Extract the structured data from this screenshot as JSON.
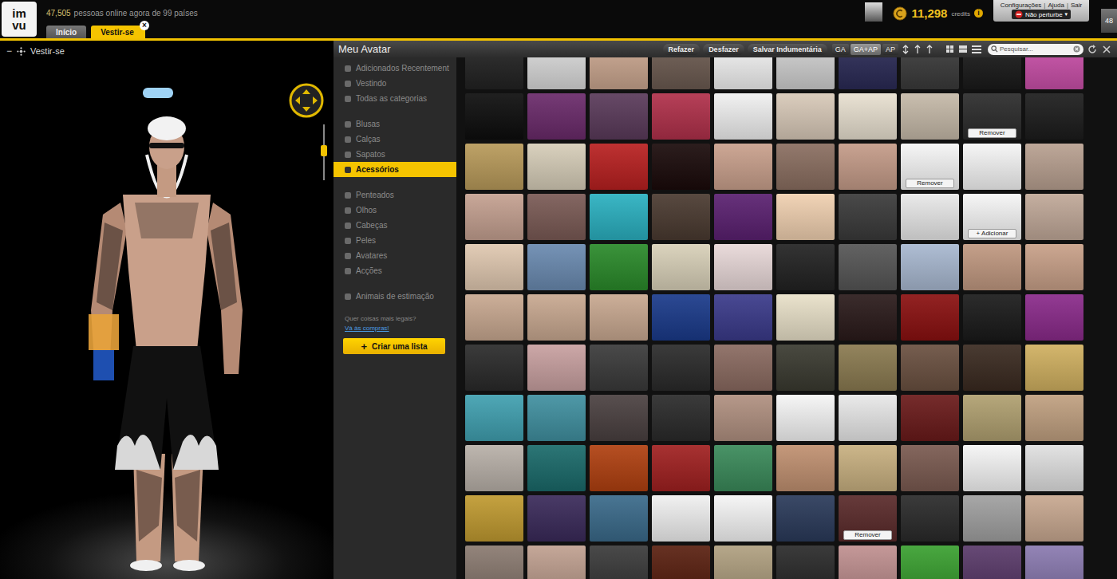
{
  "topbar": {
    "logo": [
      "im",
      "vu"
    ],
    "online": {
      "count": "47,505",
      "text": "pessoas online agora de 99 países"
    },
    "tabs": [
      {
        "label": "Início",
        "selected": false,
        "close": null
      },
      {
        "label": "Vestir-se",
        "selected": true,
        "close": "×"
      }
    ],
    "credits": {
      "amount": "11,298",
      "unit": "credits",
      "info": "i"
    },
    "links": [
      "Configurações",
      "Ajuda",
      "Sair"
    ],
    "separator": "|",
    "status": {
      "label": "Não perturbe",
      "arrow": "▾"
    },
    "badge": "48"
  },
  "stage": {
    "title": "Vestir-se",
    "collapse": "−"
  },
  "panel": {
    "title": "Meu Avatar",
    "buttons": [
      "Refazer",
      "Desfazer",
      "Salvar Indumentária"
    ],
    "filters": [
      {
        "label": "GA",
        "selected": false
      },
      {
        "label": "GA+AP",
        "selected": true
      },
      {
        "label": "AP",
        "selected": false
      }
    ],
    "search": {
      "placeholder": "Pesquisar..."
    }
  },
  "sidebar": {
    "groups": [
      [
        {
          "label": "Adicionados Recentement",
          "selected": false
        },
        {
          "label": "Vestindo",
          "selected": false
        },
        {
          "label": "Todas as categorias",
          "selected": false
        }
      ],
      [
        {
          "label": "Blusas",
          "selected": false
        },
        {
          "label": "Calças",
          "selected": false
        },
        {
          "label": "Sapatos",
          "selected": false
        },
        {
          "label": "Acessórios",
          "selected": true
        }
      ],
      [
        {
          "label": "Penteados",
          "selected": false
        },
        {
          "label": "Olhos",
          "selected": false
        },
        {
          "label": "Cabeças",
          "selected": false
        },
        {
          "label": "Peles",
          "selected": false
        },
        {
          "label": "Avatares",
          "selected": false
        },
        {
          "label": "Acções",
          "selected": false
        }
      ],
      [
        {
          "label": "Animais de estimação",
          "selected": false
        }
      ]
    ],
    "promo": "Quer coisas mais legais?",
    "promo_link": "Vá às compras!",
    "create": {
      "icon": "+",
      "label": "Criar uma lista"
    }
  },
  "tiles": [
    {
      "color": "#222222"
    },
    {
      "color": "#d9d9d9"
    },
    {
      "color": "#c9a58e"
    },
    {
      "color": "#6b5a50"
    },
    {
      "color": "#f2f2f2"
    },
    {
      "color": "#cfcfcf"
    },
    {
      "color": "#2a2a55"
    },
    {
      "color": "#3a3a3a"
    },
    {
      "color": "#1a1a1a"
    },
    {
      "color": "#c94fa8"
    },
    {
      "color": "#0d0d0d"
    },
    {
      "color": "#6a2a6a"
    },
    {
      "color": "#5a3a5a"
    },
    {
      "color": "#b0304a"
    },
    {
      "color": "#f0f0f0"
    },
    {
      "color": "#d8c9b8"
    },
    {
      "color": "#e8e0d0"
    },
    {
      "color": "#c5b9a8"
    },
    {
      "color": "#2b2b2b",
      "overlay": "Remover"
    },
    {
      "color": "#1c1c1c"
    },
    {
      "color": "#b89a5a"
    },
    {
      "color": "#d6cdb8"
    },
    {
      "color": "#b82020"
    },
    {
      "color": "#1a0a0a"
    },
    {
      "color": "#c9a08c"
    },
    {
      "color": "#8a6e60"
    },
    {
      "color": "#c49b88"
    },
    {
      "color": "#f5f5f5",
      "overlay": "Remover"
    },
    {
      "color": "#f5f5f5"
    },
    {
      "color": "#b8a090"
    },
    {
      "color": "#c4a090"
    },
    {
      "color": "#7a5a55"
    },
    {
      "color": "#2ab0c0"
    },
    {
      "color": "#4a3a30"
    },
    {
      "color": "#5a2070"
    },
    {
      "color": "#f0d0b0"
    },
    {
      "color": "#3a3a3a"
    },
    {
      "color": "#e8e8e8"
    },
    {
      "color": "#f5f5f5",
      "overlay": "+ Adicionar"
    },
    {
      "color": "#c0a898"
    },
    {
      "color": "#e0c8b0"
    },
    {
      "color": "#6a8ab0"
    },
    {
      "color": "#2a8a2a"
    },
    {
      "color": "#d8d0b8"
    },
    {
      "color": "#e8d8d8"
    },
    {
      "color": "#222222"
    },
    {
      "color": "#555555"
    },
    {
      "color": "#a8b8d0"
    },
    {
      "color": "#c09880"
    },
    {
      "color": "#c8a088"
    },
    {
      "color": "#c8a890"
    },
    {
      "color": "#c8a890"
    },
    {
      "color": "#c8a890"
    },
    {
      "color": "#1a3a8a"
    },
    {
      "color": "#3a3a8a"
    },
    {
      "color": "#e8e0c8"
    },
    {
      "color": "#2a1a1a"
    },
    {
      "color": "#8a1010"
    },
    {
      "color": "#1a1a1a"
    },
    {
      "color": "#8a2a8a"
    },
    {
      "color": "#2a2a2a"
    },
    {
      "color": "#c8a0a0"
    },
    {
      "color": "#3a3a3a"
    },
    {
      "color": "#2a2a2a"
    },
    {
      "color": "#8a6a60"
    },
    {
      "color": "#3a3a30"
    },
    {
      "color": "#8a7a50"
    },
    {
      "color": "#6a5040"
    },
    {
      "color": "#3a2a20"
    },
    {
      "color": "#d0b060"
    },
    {
      "color": "#40a0b0"
    },
    {
      "color": "#4090a0"
    },
    {
      "color": "#4a4040"
    },
    {
      "color": "#2a2a2a"
    },
    {
      "color": "#b09080"
    },
    {
      "color": "#f5f5f5"
    },
    {
      "color": "#e8e8e8"
    },
    {
      "color": "#6a1a1a"
    },
    {
      "color": "#b0a070"
    },
    {
      "color": "#c0a080"
    },
    {
      "color": "#b8b0a8"
    },
    {
      "color": "#1a6a6a"
    },
    {
      "color": "#b04010"
    },
    {
      "color": "#a02020"
    },
    {
      "color": "#3a8a5a"
    },
    {
      "color": "#c09070"
    },
    {
      "color": "#c8b080"
    },
    {
      "color": "#7a5a50"
    },
    {
      "color": "#f5f5f5"
    },
    {
      "color": "#e0e0e0"
    },
    {
      "color": "#c09a30"
    },
    {
      "color": "#3a2a5a"
    },
    {
      "color": "#3a6a8a"
    },
    {
      "color": "#f0f0f0"
    },
    {
      "color": "#f5f5f5"
    },
    {
      "color": "#2a3a5a"
    },
    {
      "color": "#5a2a2a",
      "overlay": "Remover"
    },
    {
      "color": "#2a2a2a"
    },
    {
      "color": "#a0a0a0"
    },
    {
      "color": "#c8a890"
    },
    {
      "color": "#8a7a70"
    },
    {
      "color": "#c0a090"
    },
    {
      "color": "#3a3a3a"
    },
    {
      "color": "#5a2010"
    },
    {
      "color": "#b0a080"
    },
    {
      "color": "#2a2a2a"
    },
    {
      "color": "#c09090"
    },
    {
      "color": "#3aa030"
    },
    {
      "color": "#5a3a6a"
    },
    {
      "color": "#8a7ab0"
    }
  ]
}
